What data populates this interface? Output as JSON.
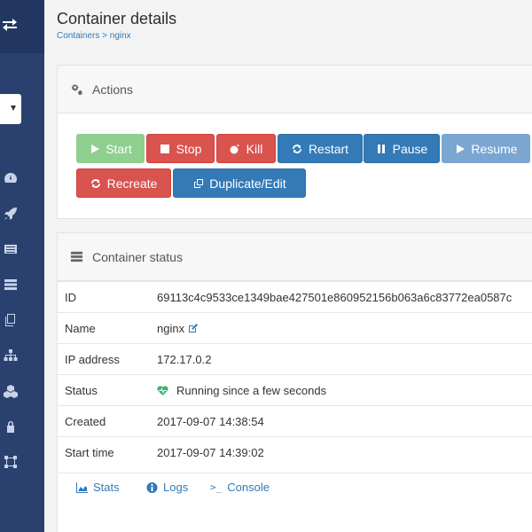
{
  "page": {
    "title": "Container details",
    "breadcrumb": {
      "root": "Containers",
      "separator": ">",
      "current": "nginx"
    }
  },
  "actions": {
    "heading": "Actions",
    "buttons": {
      "start": "Start",
      "stop": "Stop",
      "kill": "Kill",
      "restart": "Restart",
      "pause": "Pause",
      "resume": "Resume",
      "recreate": "Recreate",
      "duplicate": "Duplicate/Edit"
    }
  },
  "status": {
    "heading": "Container status",
    "rows": {
      "id": {
        "label": "ID",
        "value": "69113c4c9533ce1349bae427501e860952156b063a6c83772ea0587c"
      },
      "name": {
        "label": "Name",
        "value": "nginx"
      },
      "ip": {
        "label": "IP address",
        "value": "172.17.0.2"
      },
      "state": {
        "label": "Status",
        "value": "Running since a few seconds"
      },
      "created": {
        "label": "Created",
        "value": "2017-09-07 14:38:54"
      },
      "start": {
        "label": "Start time",
        "value": "2017-09-07 14:39:02"
      }
    },
    "links": {
      "stats": "Stats",
      "logs": "Logs",
      "console": "Console",
      "console_glyph": ">_"
    }
  },
  "icons": {
    "sidebar": [
      "switch-arrows-icon",
      "dashboard-icon",
      "rocket-icon",
      "list-icon",
      "server-icon",
      "copy-icon",
      "sitemap-icon",
      "cubes-icon",
      "lock-icon",
      "network-icon"
    ]
  },
  "colors": {
    "sidebar": "#2a4170",
    "success": "#8fcf8f",
    "danger": "#d9534f",
    "primary": "#337ab7",
    "running": "#3cb371"
  }
}
